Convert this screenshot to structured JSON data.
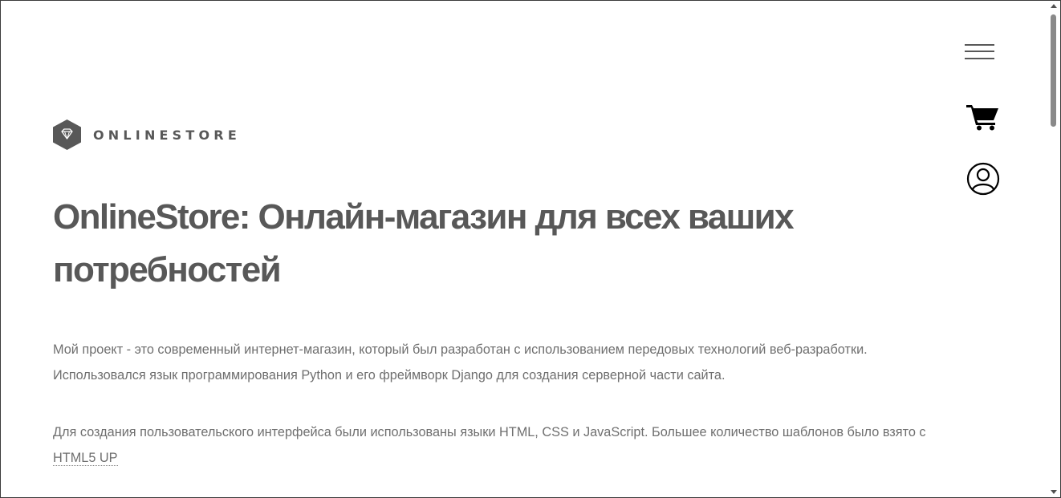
{
  "header": {
    "menu_icon": "hamburger-menu-icon",
    "cart_icon": "shopping-cart-icon",
    "account_icon": "user-circle-icon"
  },
  "logo": {
    "icon": "diamond-hexagon-icon",
    "text": "ONLINESTORE"
  },
  "main": {
    "title": "OnlineStore: Онлайн-магазин для всех ваших потребностей",
    "paragraph1_line1": "Мой проект - это современный интернет-магазин, который был разработан с использованием передовых технологий веб-разработки.",
    "paragraph1_line2": "Использовался язык программирования Python и его фреймворк Django для создания серверной части сайта.",
    "paragraph2_text": "Для создания пользовательского интерфейса были использованы языки HTML, CSS и JavaScript. Большее количество шаблонов было взято с",
    "paragraph2_link": "HTML5 UP"
  },
  "colors": {
    "text_primary": "#585858",
    "text_body": "#6f6f6f",
    "background": "#ffffff"
  }
}
